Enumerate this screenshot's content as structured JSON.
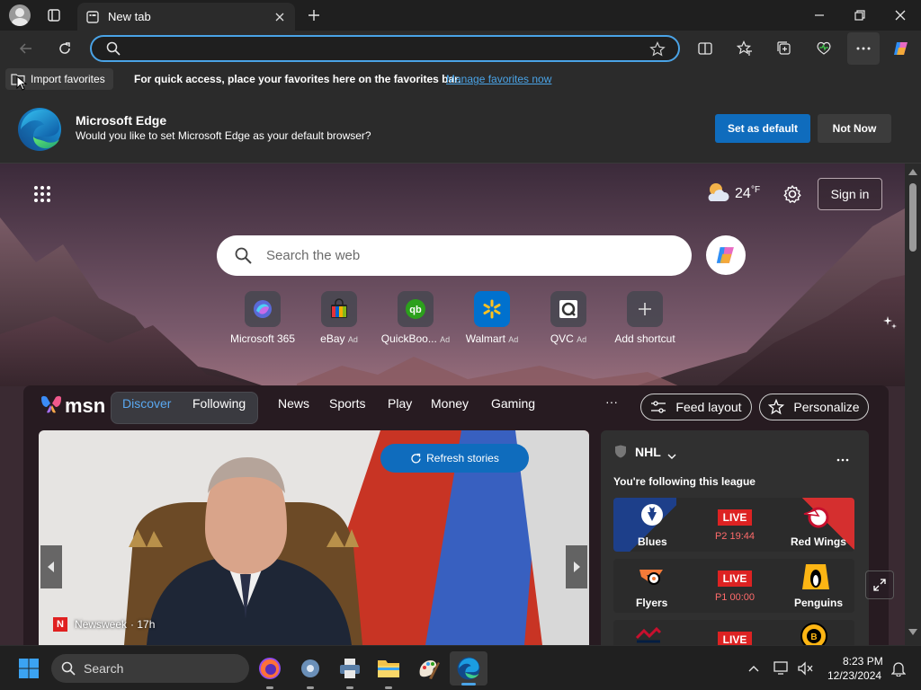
{
  "browser": {
    "tab_title": "New tab",
    "address_value": "",
    "favbar": {
      "import_label": "Import favorites",
      "message": "For quick access, place your favorites here on the favorites bar.",
      "manage_link": "Manage favorites now"
    },
    "default_prompt": {
      "title": "Microsoft Edge",
      "message": "Would you like to set Microsoft Edge as your default browser?",
      "set_default_label": "Set as default",
      "not_now_label": "Not Now"
    }
  },
  "newtab": {
    "weather_temp": "24",
    "weather_unit": "°F",
    "sign_in_label": "Sign in",
    "search_placeholder": "Search the web",
    "shortcuts": [
      {
        "label": "Microsoft 365",
        "ad": ""
      },
      {
        "label": "eBay",
        "ad": "Ad"
      },
      {
        "label": "QuickBoo...",
        "ad": "Ad"
      },
      {
        "label": "Walmart",
        "ad": "Ad"
      },
      {
        "label": "QVC",
        "ad": "Ad"
      },
      {
        "label": "Add shortcut",
        "ad": ""
      }
    ]
  },
  "feed": {
    "brand": "msn",
    "tabs": [
      "Discover",
      "Following",
      "News",
      "Sports",
      "Play",
      "Money",
      "Gaming"
    ],
    "more": "···",
    "feed_layout_label": "Feed layout",
    "personalize_label": "Personalize",
    "refresh_label": "Refresh stories",
    "story": {
      "source": "Newsweek",
      "age": "· 17h",
      "source_initial": "N"
    }
  },
  "nhl": {
    "league": "NHL",
    "following_text": "You're following this league",
    "games": [
      {
        "home": "Blues",
        "away": "Red Wings",
        "status": "LIVE",
        "time": "P2 19:44"
      },
      {
        "home": "Flyers",
        "away": "Penguins",
        "status": "LIVE",
        "time": "P1 00:00"
      },
      {
        "home": "",
        "away": "",
        "status": "LIVE",
        "time": ""
      }
    ]
  },
  "taskbar": {
    "search_label": "Search",
    "time": "8:23 PM",
    "date": "12/23/2024"
  },
  "colors": {
    "accent": "#0f6cbd",
    "link": "#4aa3e6",
    "live": "#dd2222"
  }
}
